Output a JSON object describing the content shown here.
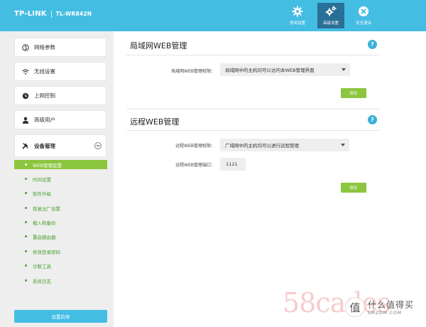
{
  "header": {
    "brand": "TP-LINK",
    "model": "TL-WR842N",
    "nav": [
      {
        "label": "常用设置",
        "icon": "gear-icon"
      },
      {
        "label": "高级设置",
        "icon": "gears-icon"
      },
      {
        "label": "安全退出",
        "icon": "close-circle-icon"
      }
    ]
  },
  "sidebar": {
    "menus": [
      {
        "label": "网络参数",
        "icon": "globe-icon"
      },
      {
        "label": "无线设置",
        "icon": "wifi-icon"
      },
      {
        "label": "上网控制",
        "icon": "internet-control-icon"
      },
      {
        "label": "高级用户",
        "icon": "user-icon"
      },
      {
        "label": "设备管理",
        "icon": "tools-icon"
      }
    ],
    "submenu": [
      "WEB管理设置",
      "时间设置",
      "软件升级",
      "恢复出厂设置",
      "载入和备份",
      "重启路由器",
      "修改登录密码",
      "诊断工具",
      "系统日志"
    ],
    "wizard_label": "设置向导"
  },
  "local_section": {
    "title": "局域网WEB管理",
    "help": "?",
    "field_label": "局域网WEB管理权限：",
    "select_value": "局域网中的主机均可以访问本WEB管理界面",
    "save_label": "保存"
  },
  "remote_section": {
    "title": "远程WEB管理",
    "help": "?",
    "perm_label": "远程WEB管理权限：",
    "perm_value": "广域网中的主机均可以进行远程管理",
    "port_label": "远程WEB管理端口：",
    "port_value": "1121",
    "save_label": "保存"
  },
  "watermark": {
    "text": "58cades",
    "smzdm_main": "什么值得买",
    "smzdm_sub": "SMZDM.COM",
    "smzdm_badge": "值"
  },
  "colors": {
    "header_bg": "#44bde3",
    "accent_green": "#8cc63f",
    "nav_active": "#2a6f95",
    "sidebar_bg": "#eeeeee"
  }
}
